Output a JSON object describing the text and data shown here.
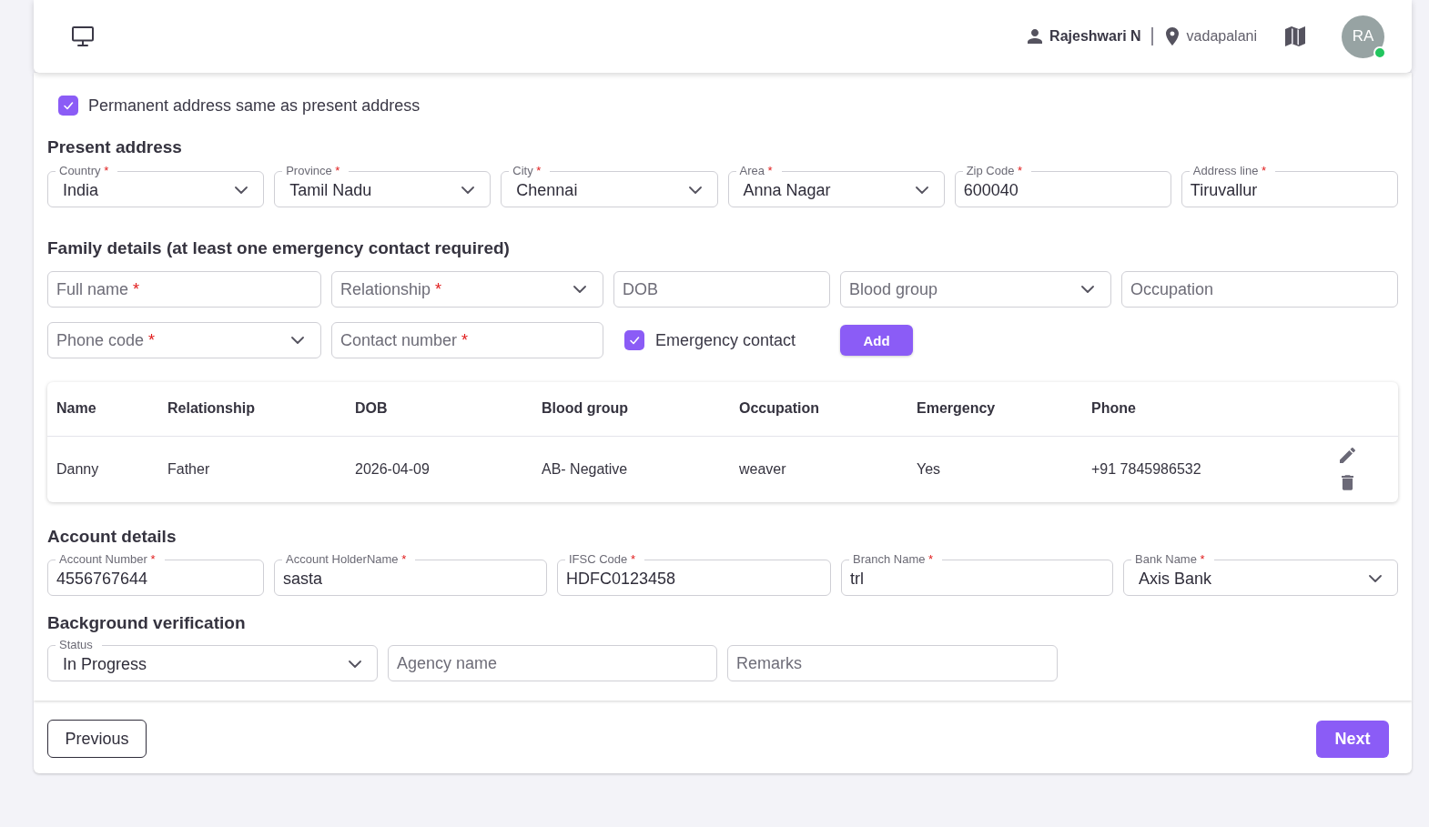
{
  "top_bar": {
    "user": "Rajeshwari N",
    "location": "vadapalani",
    "avatar": {
      "initials": "RA",
      "online": true
    }
  },
  "permanent_same": {
    "label": "Permanent address same as present address",
    "checked": true
  },
  "present_address": {
    "title": "Present address",
    "fields": [
      {
        "kind": "select",
        "label": "Country",
        "asterisk": "*",
        "value": "India"
      },
      {
        "kind": "select",
        "label": "Province",
        "asterisk": "*",
        "value": "Tamil Nadu"
      },
      {
        "kind": "select",
        "label": "City",
        "asterisk": "*",
        "value": "Chennai"
      },
      {
        "kind": "select",
        "label": "Area",
        "asterisk": "*",
        "value": "Anna Nagar"
      },
      {
        "kind": "text",
        "label": "Zip Code",
        "asterisk": "*",
        "value": "600040"
      },
      {
        "kind": "text",
        "label": "Address line",
        "asterisk": "*",
        "value": "Tiruvallur"
      }
    ]
  },
  "family": {
    "title": "Family details (at least one emergency contact required)",
    "fields": [
      {
        "kind": "text",
        "placeholder": "Full name",
        "asterisk": "*"
      },
      {
        "kind": "select",
        "placeholder": "Relationship",
        "asterisk": "*"
      },
      {
        "kind": "text",
        "placeholder": "DOB"
      },
      {
        "kind": "select",
        "placeholder": "Blood group"
      },
      {
        "kind": "text",
        "placeholder": "Occupation"
      },
      {
        "kind": "select",
        "placeholder": "Phone code",
        "asterisk": "*"
      },
      {
        "kind": "text",
        "placeholder": "Contact number",
        "asterisk": "*"
      }
    ],
    "emergency_contact": {
      "label": "Emergency contact",
      "checked": true
    },
    "add_button": "Add",
    "table": {
      "columns": [
        "Name",
        "Relationship",
        "DOB",
        "Blood group",
        "Occupation",
        "Emergency",
        "Phone"
      ],
      "rows": [
        {
          "cells": [
            "Danny",
            "Father",
            "2026-04-09",
            "AB- Negative",
            "weaver",
            "Yes",
            "+91 7845986532"
          ]
        }
      ]
    }
  },
  "account": {
    "title": "Account details",
    "fields": [
      {
        "kind": "text",
        "label": "Account Number",
        "asterisk": "*",
        "value": "4556767644"
      },
      {
        "kind": "text",
        "label": "Account HolderName",
        "asterisk": "*",
        "value": "sasta"
      },
      {
        "kind": "text",
        "label": "IFSC Code",
        "asterisk": "*",
        "value": "HDFC0123458"
      },
      {
        "kind": "text",
        "label": "Branch Name",
        "asterisk": "*",
        "value": "trl"
      },
      {
        "kind": "select",
        "label": "Bank Name",
        "asterisk": "*",
        "value": "Axis Bank"
      }
    ]
  },
  "background": {
    "title": "Background verification",
    "fields": [
      {
        "kind": "select",
        "label": "Status",
        "value": "In Progress"
      },
      {
        "kind": "text",
        "placeholder": "Agency name"
      },
      {
        "kind": "text",
        "placeholder": "Remarks"
      }
    ]
  },
  "footer": {
    "previous": "Previous",
    "next": "Next"
  }
}
